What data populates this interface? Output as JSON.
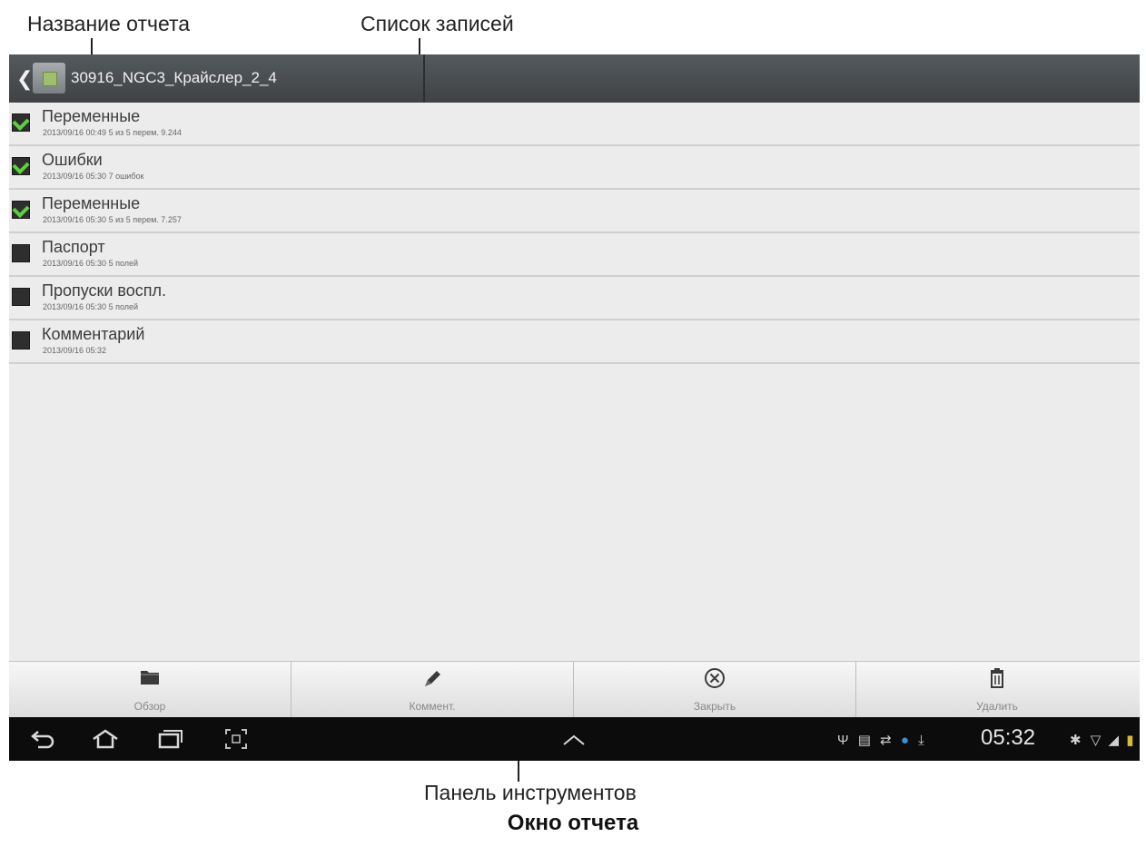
{
  "annotations": {
    "report_name": "Название отчета",
    "record_list": "Список записей",
    "toolbar": "Панель инструментов"
  },
  "caption": "Окно отчета",
  "action_bar": {
    "back_icon": "chevron-left-icon",
    "app_icon": "scanner-device-icon",
    "report_title": "30916_NGC3_Крайслер_2_4"
  },
  "records": [
    {
      "title": "Переменные",
      "subtitle": "2013/09/16 00:49  5 из 5 перем. 9.244",
      "checked": true
    },
    {
      "title": "Ошибки",
      "subtitle": "2013/09/16 05:30  7 ошибок",
      "checked": true
    },
    {
      "title": "Переменные",
      "subtitle": "2013/09/16 05:30  5 из 5 перем. 7.257",
      "checked": true
    },
    {
      "title": "Паспорт",
      "subtitle": "2013/09/16 05:30  5 полей",
      "checked": false
    },
    {
      "title": "Пропуски воспл.",
      "subtitle": "2013/09/16 05:30  5 полей",
      "checked": false
    },
    {
      "title": "Комментарий",
      "subtitle": "2013/09/16 05:32",
      "checked": false
    }
  ],
  "toolbar": {
    "browse": {
      "label": "Обзор",
      "icon": "folder-icon"
    },
    "comment": {
      "label": "Коммент.",
      "icon": "pen-icon"
    },
    "close": {
      "label": "Закрыть",
      "icon": "close-circle-icon"
    },
    "delete": {
      "label": "Удалить",
      "icon": "trash-icon"
    }
  },
  "status_bar": {
    "time": "05:32"
  },
  "colors": {
    "action_bar": "#4a4e51",
    "list_background": "#ececec",
    "checkmark": "#5ecf3e",
    "nav_bar": "#0c0c0c"
  }
}
